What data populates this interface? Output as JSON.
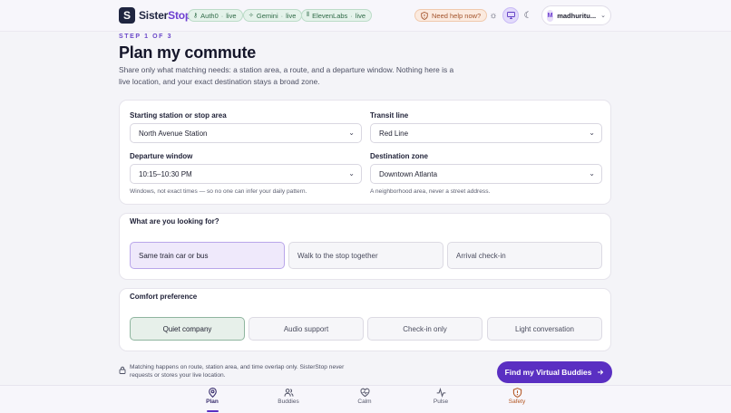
{
  "brand": {
    "mark": "S",
    "name_primary": "Sister",
    "name_accent": "Stop",
    "accent_color": "#6d3fd0"
  },
  "status_pills": [
    {
      "name": "Auth0",
      "state": "live",
      "icon": "key-icon"
    },
    {
      "name": "Gemini",
      "state": "live",
      "icon": "sparkle-icon"
    },
    {
      "name": "ElevenLabs",
      "state": "live",
      "icon": "voice-icon"
    }
  ],
  "help": {
    "label": "Need help now?",
    "icon": "shield-alert-icon"
  },
  "theme_buttons": [
    {
      "icon": "sun-icon",
      "active": false
    },
    {
      "icon": "monitor-icon",
      "active": true
    },
    {
      "icon": "moon-icon",
      "active": false
    }
  ],
  "user": {
    "initial": "M",
    "name": "madhuritu..."
  },
  "heading": {
    "step": "STEP 1 OF 3",
    "title": "Plan my commute",
    "subtitle": "Share only what matching needs: a station area, a route, and a departure window. Nothing here is a live location, and your exact destination stays a broad zone."
  },
  "form": {
    "start_label": "Starting station or stop area",
    "start_value": "North Avenue Station",
    "line_label": "Transit line",
    "line_value": "Red Line",
    "window_label": "Departure window",
    "window_value": "10:15–10:30 PM",
    "window_hint": "Windows, not exact times — so no one can infer your daily pattern.",
    "zone_label": "Destination zone",
    "zone_value": "Downtown Atlanta",
    "zone_hint": "A neighborhood area, never a street address."
  },
  "looking_for": {
    "label": "What are you looking for?",
    "options": [
      "Same train car or bus",
      "Walk to the stop together",
      "Arrival check-in"
    ],
    "selected": 0
  },
  "comfort": {
    "label": "Comfort preference",
    "options": [
      "Quiet company",
      "Audio support",
      "Check-in only",
      "Light conversation"
    ],
    "selected": 0
  },
  "privacy_note": "Matching happens on route, station area, and time overlap only. SisterStop never requests or stores your live location.",
  "cta": {
    "label": "Find my Virtual Buddies",
    "icon": "arrow-right-icon"
  },
  "bottom_nav": [
    {
      "label": "Plan",
      "icon": "map-pin-icon",
      "active": true
    },
    {
      "label": "Buddies",
      "icon": "users-icon",
      "active": false
    },
    {
      "label": "Calm",
      "icon": "heart-icon",
      "active": false
    },
    {
      "label": "Pulse",
      "icon": "activity-icon",
      "active": false
    },
    {
      "label": "Safety",
      "icon": "shield-alert-icon",
      "active": false
    }
  ],
  "colors": {
    "primary": "#5a2fc2",
    "live_green": "#2f6a47",
    "help_orange": "#a2522a",
    "safety_orange": "#b2541f"
  }
}
